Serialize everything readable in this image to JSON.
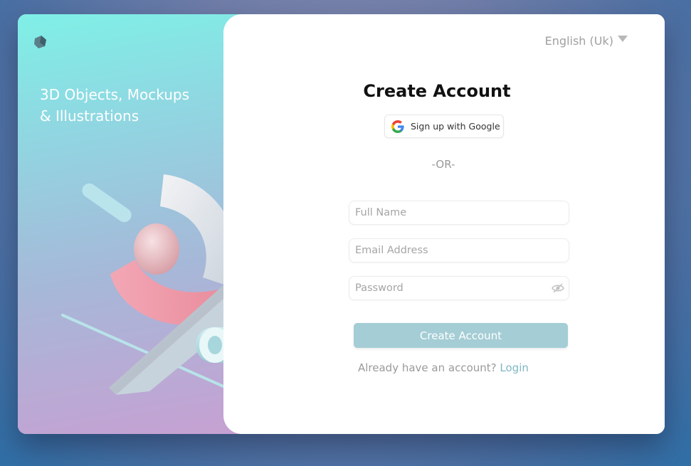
{
  "brand": {
    "logo_icon": "cube-logo-icon"
  },
  "hero": {
    "tagline": "3D Objects, Mockups\n& Illustrations"
  },
  "language": {
    "selected": "English (Uk)",
    "icon": "caret-down-icon"
  },
  "form": {
    "title": "Create Account",
    "google_button": {
      "label": "Sign up with Google",
      "icon": "google-icon"
    },
    "divider": "-OR-",
    "full_name": {
      "placeholder": "Full Name",
      "value": ""
    },
    "email": {
      "placeholder": "Email Address",
      "value": ""
    },
    "password": {
      "placeholder": "Password",
      "value": "",
      "icon": "eye-hidden-icon"
    },
    "submit_label": "Create Account",
    "login_prompt": "Already have an account?",
    "login_link": "Login"
  },
  "colors": {
    "accent": "#a4cdd5",
    "link": "#7fb7c4",
    "panel_top": "#7ff0e6",
    "panel_bottom": "#c7a0d2"
  }
}
